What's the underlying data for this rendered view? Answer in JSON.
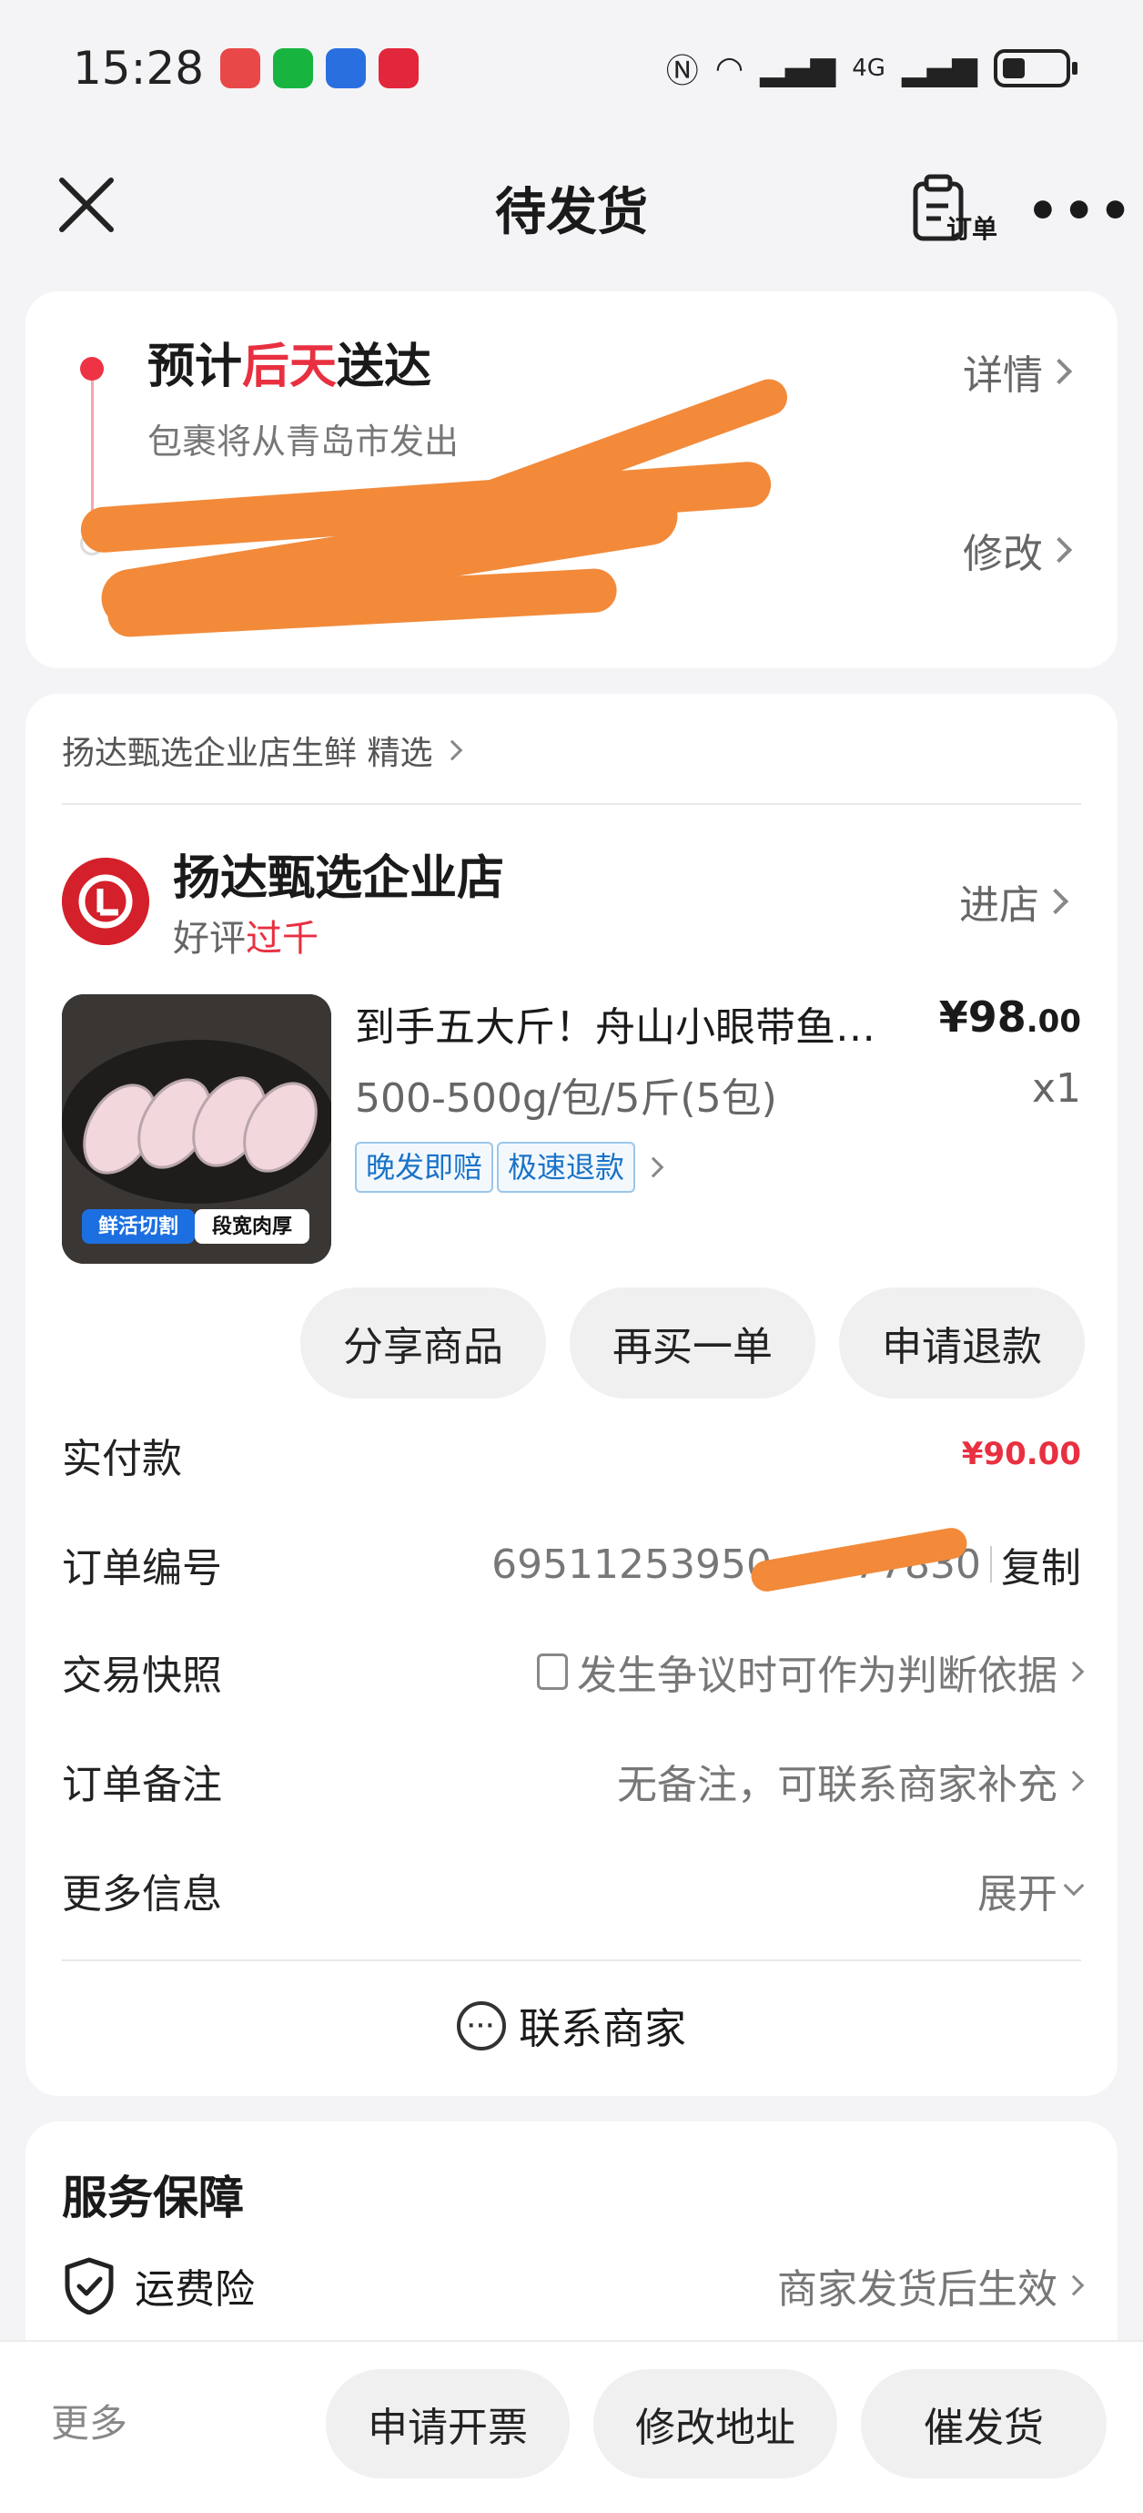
{
  "status_bar": {
    "time": "15:28",
    "network": "4G"
  },
  "nav": {
    "title": "待发货",
    "order_icon_label": "订单",
    "more": "•••"
  },
  "delivery": {
    "title_prefix": "预计",
    "title_highlight": "后天",
    "title_suffix": "送达",
    "subtitle": "包裹将从青岛市发出",
    "details_link": "详情",
    "modify_link": "修改"
  },
  "order": {
    "shop_crumb": "扬达甄选企业店生鲜 精选",
    "shop_name": "扬达甄选企业店",
    "shop_rating_prefix": "好评",
    "shop_rating_highlight": "过千",
    "enter_shop": "进店",
    "product": {
      "title": "到手五大斤！舟山小眼带鱼…",
      "price_int": "¥98",
      "price_dec": ".00",
      "spec": "500-500g/包/5斤(5包)",
      "qty": "x1",
      "image_caption_1": "鲜活切割",
      "image_caption_2": "段宽肉厚",
      "tags": [
        "晚发即赔",
        "极速退款"
      ]
    },
    "actions": [
      "分享商品",
      "再买一单",
      "申请退款"
    ],
    "rows": {
      "paid_label": "实付款",
      "paid_int": "¥90",
      "paid_dec": ".00",
      "order_no_label": "订单编号",
      "order_no_start": "69511253950",
      "order_no_end": "77830",
      "copy": "复制",
      "snapshot_label": "交易快照",
      "snapshot_value": "发生争议时可作为判断依据",
      "note_label": "订单备注",
      "note_value": "无备注，可联系商家补充",
      "more_info_label": "更多信息",
      "more_info_value": "展开"
    },
    "contact": "联系商家"
  },
  "service": {
    "title": "服务保障",
    "item_label": "运费险",
    "item_value": "商家发货后生效"
  },
  "bottom_bar": {
    "more": "更多",
    "buttons": [
      "申请开票",
      "修改地址",
      "催发货"
    ]
  },
  "colors": {
    "accent_red": "#e83040",
    "redaction_orange": "#f28a3a"
  }
}
